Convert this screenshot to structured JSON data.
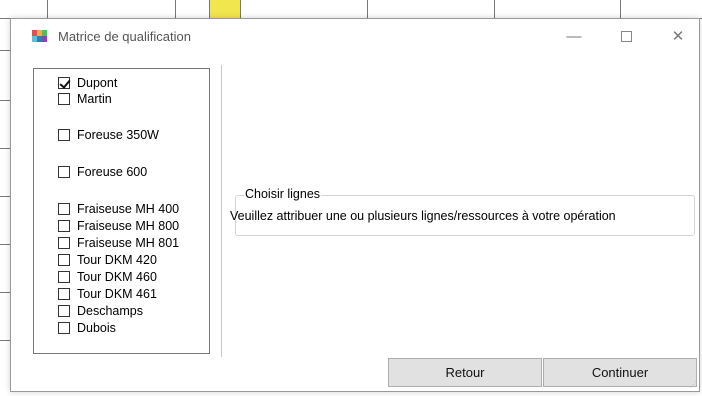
{
  "window": {
    "title": "Matrice de qualification",
    "controls": {
      "minimize": "—",
      "maximize": "",
      "close": "✕"
    }
  },
  "resources": [
    {
      "label": "Dupont",
      "checked": true
    },
    {
      "label": "Martin",
      "checked": false
    },
    {
      "label": "Foreuse 350W",
      "checked": false
    },
    {
      "label": "Foreuse 600",
      "checked": false
    },
    {
      "label": "Fraiseuse MH 400",
      "checked": false
    },
    {
      "label": "Fraiseuse MH 800",
      "checked": false
    },
    {
      "label": "Fraiseuse MH 801",
      "checked": false
    },
    {
      "label": "Tour DKM 420",
      "checked": false
    },
    {
      "label": "Tour DKM 460",
      "checked": false
    },
    {
      "label": "Tour DKM 461",
      "checked": false
    },
    {
      "label": "Deschamps",
      "checked": false
    },
    {
      "label": "Dubois",
      "checked": false
    }
  ],
  "group": {
    "legend": "Choisir lignes",
    "message": "Veuillez attribuer une ou plusieurs lignes/ressources à votre opération"
  },
  "buttons": {
    "back": "Retour",
    "continue": "Continuer"
  },
  "colors": {
    "highlight_cell": "#f2e64e",
    "button_bg": "#e1e1e1"
  }
}
